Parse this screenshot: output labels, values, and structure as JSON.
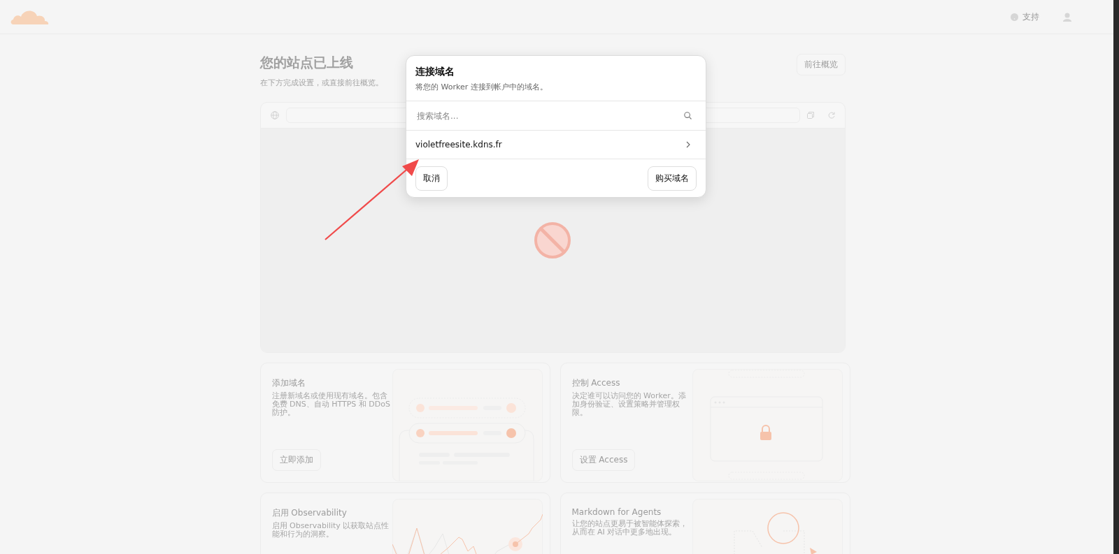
{
  "header": {
    "support_label": "支持"
  },
  "page": {
    "title": "您的站点已上线",
    "subtitle": "在下方完成设置，或直接前往概览。",
    "overview_button": "前往概览"
  },
  "cards": [
    {
      "kind": "domains",
      "title": "添加域名",
      "description": "注册新域名或使用现有域名。包含免费 DNS、自动 HTTPS 和 DDoS 防护。",
      "button": "立即添加"
    },
    {
      "kind": "access",
      "title": "控制 Access",
      "description": "决定谁可以访问您的 Worker。添加身份验证、设置策略并管理权限。",
      "button": "设置 Access"
    },
    {
      "kind": "observability",
      "title": "启用 Observability",
      "description": "启用 Observability 以获取站点性能和行为的洞察。"
    },
    {
      "kind": "markdown",
      "title": "Markdown for Agents",
      "description": "让您的站点更易于被智能体探索，从而在 AI 对话中更多地出现。"
    }
  ],
  "dialog": {
    "title": "连接域名",
    "description": "将您的 Worker 连接到帐户中的域名。",
    "search": {
      "placeholder": "搜索域名..."
    },
    "domains": [
      {
        "name": "violetfreesite.kdns.fr"
      }
    ],
    "buttons": [
      {
        "kind": "cancel",
        "label": "取消"
      },
      {
        "kind": "buy",
        "label": "购买域名"
      }
    ]
  },
  "annotation": {
    "kind": "arrow"
  }
}
